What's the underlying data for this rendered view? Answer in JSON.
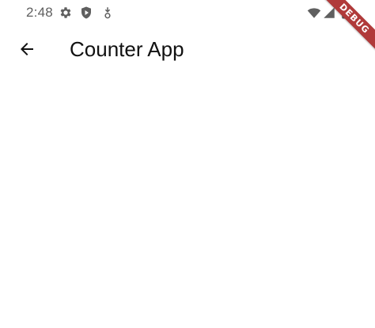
{
  "status_bar": {
    "time": "2:48",
    "left_icons": [
      "gear-icon",
      "shield-icon",
      "download-icon"
    ],
    "right_icons": [
      "wifi-icon",
      "signal-icon",
      "battery-icon"
    ]
  },
  "app_bar": {
    "title": "Counter App",
    "back_icon": "arrow-back-icon"
  },
  "debug_banner": {
    "label": "DEBUG",
    "color": "#b03a3a"
  }
}
